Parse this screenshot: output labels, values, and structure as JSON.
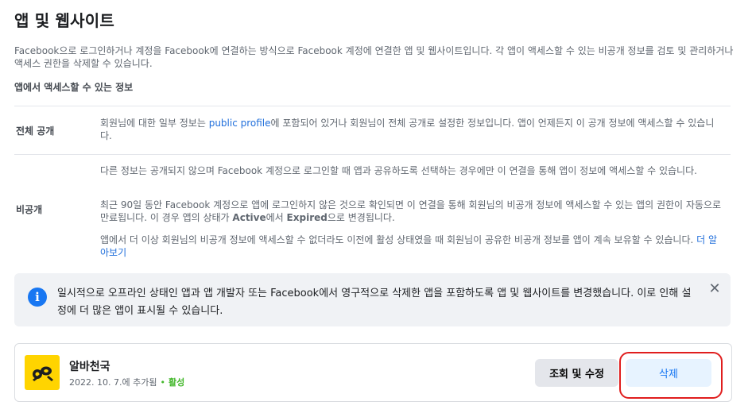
{
  "page": {
    "title": "앱 및 웹사이트",
    "description": "Facebook으로 로그인하거나 계정을 Facebook에 연결하는 방식으로 Facebook 계정에 연결한 앱 및 웹사이트입니다. 각 앱이 액세스할 수 있는 비공개 정보를 검토 및 관리하거나 액세스 권한을 삭제할 수 있습니다."
  },
  "info_section": {
    "title": "앱에서 액세스할 수 있는 정보",
    "public": {
      "label": "전체 공개",
      "text_before": "회원님에 대한 일부 정보는 ",
      "link": "public profile",
      "text_after": "에 포함되어 있거나 회원님이 전체 공개로 설정한 정보입니다. 앱이 언제든지 이 공개 정보에 액세스할 수 있습니다."
    },
    "private": {
      "label": "비공개",
      "para1": "다른 정보는 공개되지 않으며 Facebook 계정으로 로그인할 때 앱과 공유하도록 선택하는 경우에만 이 연결을 통해 앱이 정보에 액세스할 수 있습니다.",
      "para2_a": "최근 90일 동안 Facebook 계정으로 앱에 로그인하지 않은 것으로 확인되면 이 연결을 통해 회원님의 비공개 정보에 액세스할 수 있는 앱의 권한이 자동으로 만료됩니다. 이 경우 앱의 상태가 ",
      "status_active": "Active",
      "para2_b": "에서 ",
      "status_expired": "Expired",
      "para2_c": "으로 변경됩니다.",
      "para3": "앱에서 더 이상 회원님의 비공개 정보에 액세스할 수 없더라도 이전에 활성 상태였을 때 회원님이 공유한 비공개 정보를 앱이 계속 보유할 수 있습니다. ",
      "learn_more": "더 알아보기"
    }
  },
  "notice": {
    "icon": "info-icon",
    "text": "일시적으로 오프라인 상태인 앱과 앱 개발자 또는 Facebook에서 영구적으로 삭제한 앱을 포함하도록 앱 및 웹사이트를 변경했습니다. 이로 인해 설정에 더 많은 앱이 표시될 수 있습니다.",
    "close_icon": "✕"
  },
  "app": {
    "name": "알바천국",
    "added": "2022. 10. 7.에 추가됨",
    "dot": "•",
    "status": "활성",
    "view_button": "조회 및 수정",
    "delete_button": "삭제"
  },
  "colors": {
    "accent": "#1877f2",
    "link": "#216fdb",
    "status_active": "#42b72a",
    "logo_bg": "#ffd400",
    "highlight": "#e01e1e"
  }
}
